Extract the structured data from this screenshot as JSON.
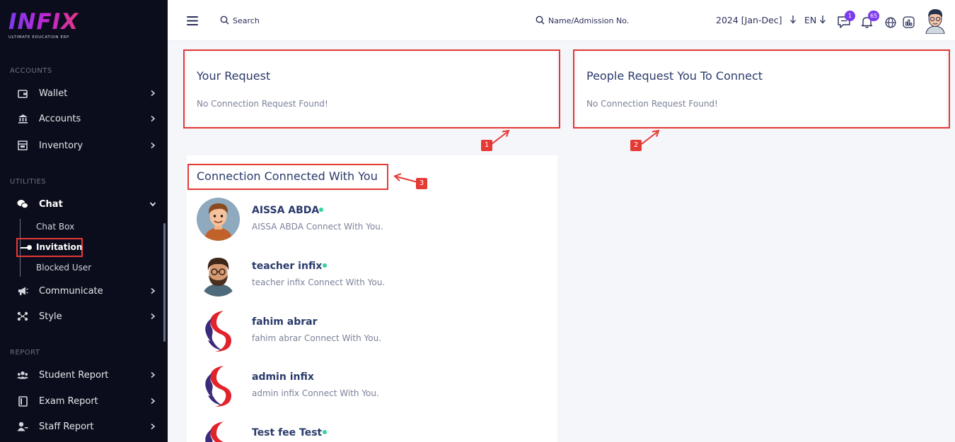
{
  "brand": {
    "name": "INFIX",
    "tagline": "ULTIMATE EDUCATION ERP"
  },
  "sidebar": {
    "sections": [
      {
        "title": "ACCOUNTS",
        "items": [
          {
            "label": "Wallet",
            "icon": "wallet-icon"
          },
          {
            "label": "Accounts",
            "icon": "bank-icon"
          },
          {
            "label": "Inventory",
            "icon": "inventory-icon"
          }
        ]
      },
      {
        "title": "UTILITIES",
        "items": [
          {
            "label": "Chat",
            "icon": "chat-icon",
            "expanded": true,
            "children": [
              {
                "label": "Chat Box"
              },
              {
                "label": "Invitation",
                "active": true
              },
              {
                "label": "Blocked User"
              }
            ]
          },
          {
            "label": "Communicate",
            "icon": "megaphone-icon"
          },
          {
            "label": "Style",
            "icon": "style-icon"
          }
        ]
      },
      {
        "title": "REPORT",
        "items": [
          {
            "label": "Student Report",
            "icon": "users-icon"
          },
          {
            "label": "Exam Report",
            "icon": "exam-icon"
          },
          {
            "label": "Staff Report",
            "icon": "staff-icon"
          }
        ]
      }
    ]
  },
  "header": {
    "search_label": "Search",
    "student_search_label": "Name/Admission No.",
    "session": "2024 [Jan-Dec]",
    "language": "EN",
    "message_count": "1",
    "notification_count": "65"
  },
  "main": {
    "your_request": {
      "title": "Your Request",
      "empty": "No Connection Request Found!"
    },
    "people_request": {
      "title": "People Request You To Connect",
      "empty": "No Connection Request Found!"
    },
    "connected": {
      "title": "Connection Connected With You",
      "contacts": [
        {
          "name": "AISSA ABDA",
          "message": "AISSA ABDA Connect With You.",
          "online": true,
          "avatar": "cartoon-man-avatar"
        },
        {
          "name": "teacher infix",
          "message": "teacher infix Connect With You.",
          "online": true,
          "avatar": "bearded-man-avatar"
        },
        {
          "name": "fahim abrar",
          "message": "fahim abrar Connect With You.",
          "online": false,
          "avatar": "school-logo-avatar"
        },
        {
          "name": "admin infix",
          "message": "admin infix Connect With You.",
          "online": false,
          "avatar": "school-logo-avatar"
        },
        {
          "name": "Test fee Test",
          "message": "",
          "online": true,
          "avatar": "school-logo-avatar"
        }
      ]
    }
  },
  "annotations": [
    "1",
    "2",
    "3"
  ],
  "colors": {
    "sidebar_bg": "#0b0d1c",
    "accent": "#7c3aed",
    "highlight": "#e53935",
    "online": "#34d399",
    "title": "#2a3a6b"
  }
}
